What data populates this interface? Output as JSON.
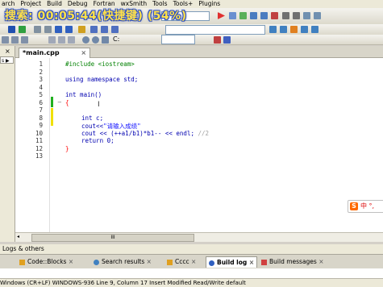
{
  "menubar": {
    "items": [
      "arch",
      "Project",
      "Build",
      "Debug",
      "Fortran",
      "wxSmith",
      "Tools",
      "Tools+",
      "Plugins"
    ]
  },
  "overlay": {
    "text": "搜索: 00:05:44(快捷键) (54%)"
  },
  "toolbar": {
    "cc_symbol": "C:"
  },
  "left_panel": {
    "close": "×",
    "item": "s ▶"
  },
  "editor": {
    "tab_label": "*main.cpp",
    "tab_close": "×",
    "line_numbers": [
      "1",
      "2",
      "3",
      "4",
      "5",
      "6",
      "7",
      "8",
      "9",
      "10",
      "11",
      "12",
      "13"
    ],
    "code": {
      "l1": "#include <iostream>",
      "l3a": "using namespace std;",
      "l5a": "int main()",
      "l6": "{",
      "l8a": "int c;",
      "l9a": "cout<<",
      "l9b": "\"请输入成绩\"",
      "l10a": "cout << (++a1/b1)*b1-- << endl;",
      "l10b": "//2",
      "l11a": "return 0;",
      "l12": "}"
    },
    "scroll_label": "III",
    "ime": {
      "badge": "S",
      "text": "中 °,"
    }
  },
  "logs": {
    "title": "Logs & others",
    "tabs": [
      {
        "label": "Code::Blocks"
      },
      {
        "label": "Search results"
      },
      {
        "label": "Cccc"
      },
      {
        "label": "Build log"
      },
      {
        "label": "Build messages"
      }
    ],
    "close": "×"
  },
  "statusbar": {
    "text": "Windows (CR+LF)    WINDOWS-936    Line 9, Column 17    Insert    Modified    Read/Write    default"
  },
  "colors": {
    "accent": "#ffe14a",
    "keyword": "#0000b0",
    "preprocessor": "#008000",
    "string": "#1010ff"
  }
}
